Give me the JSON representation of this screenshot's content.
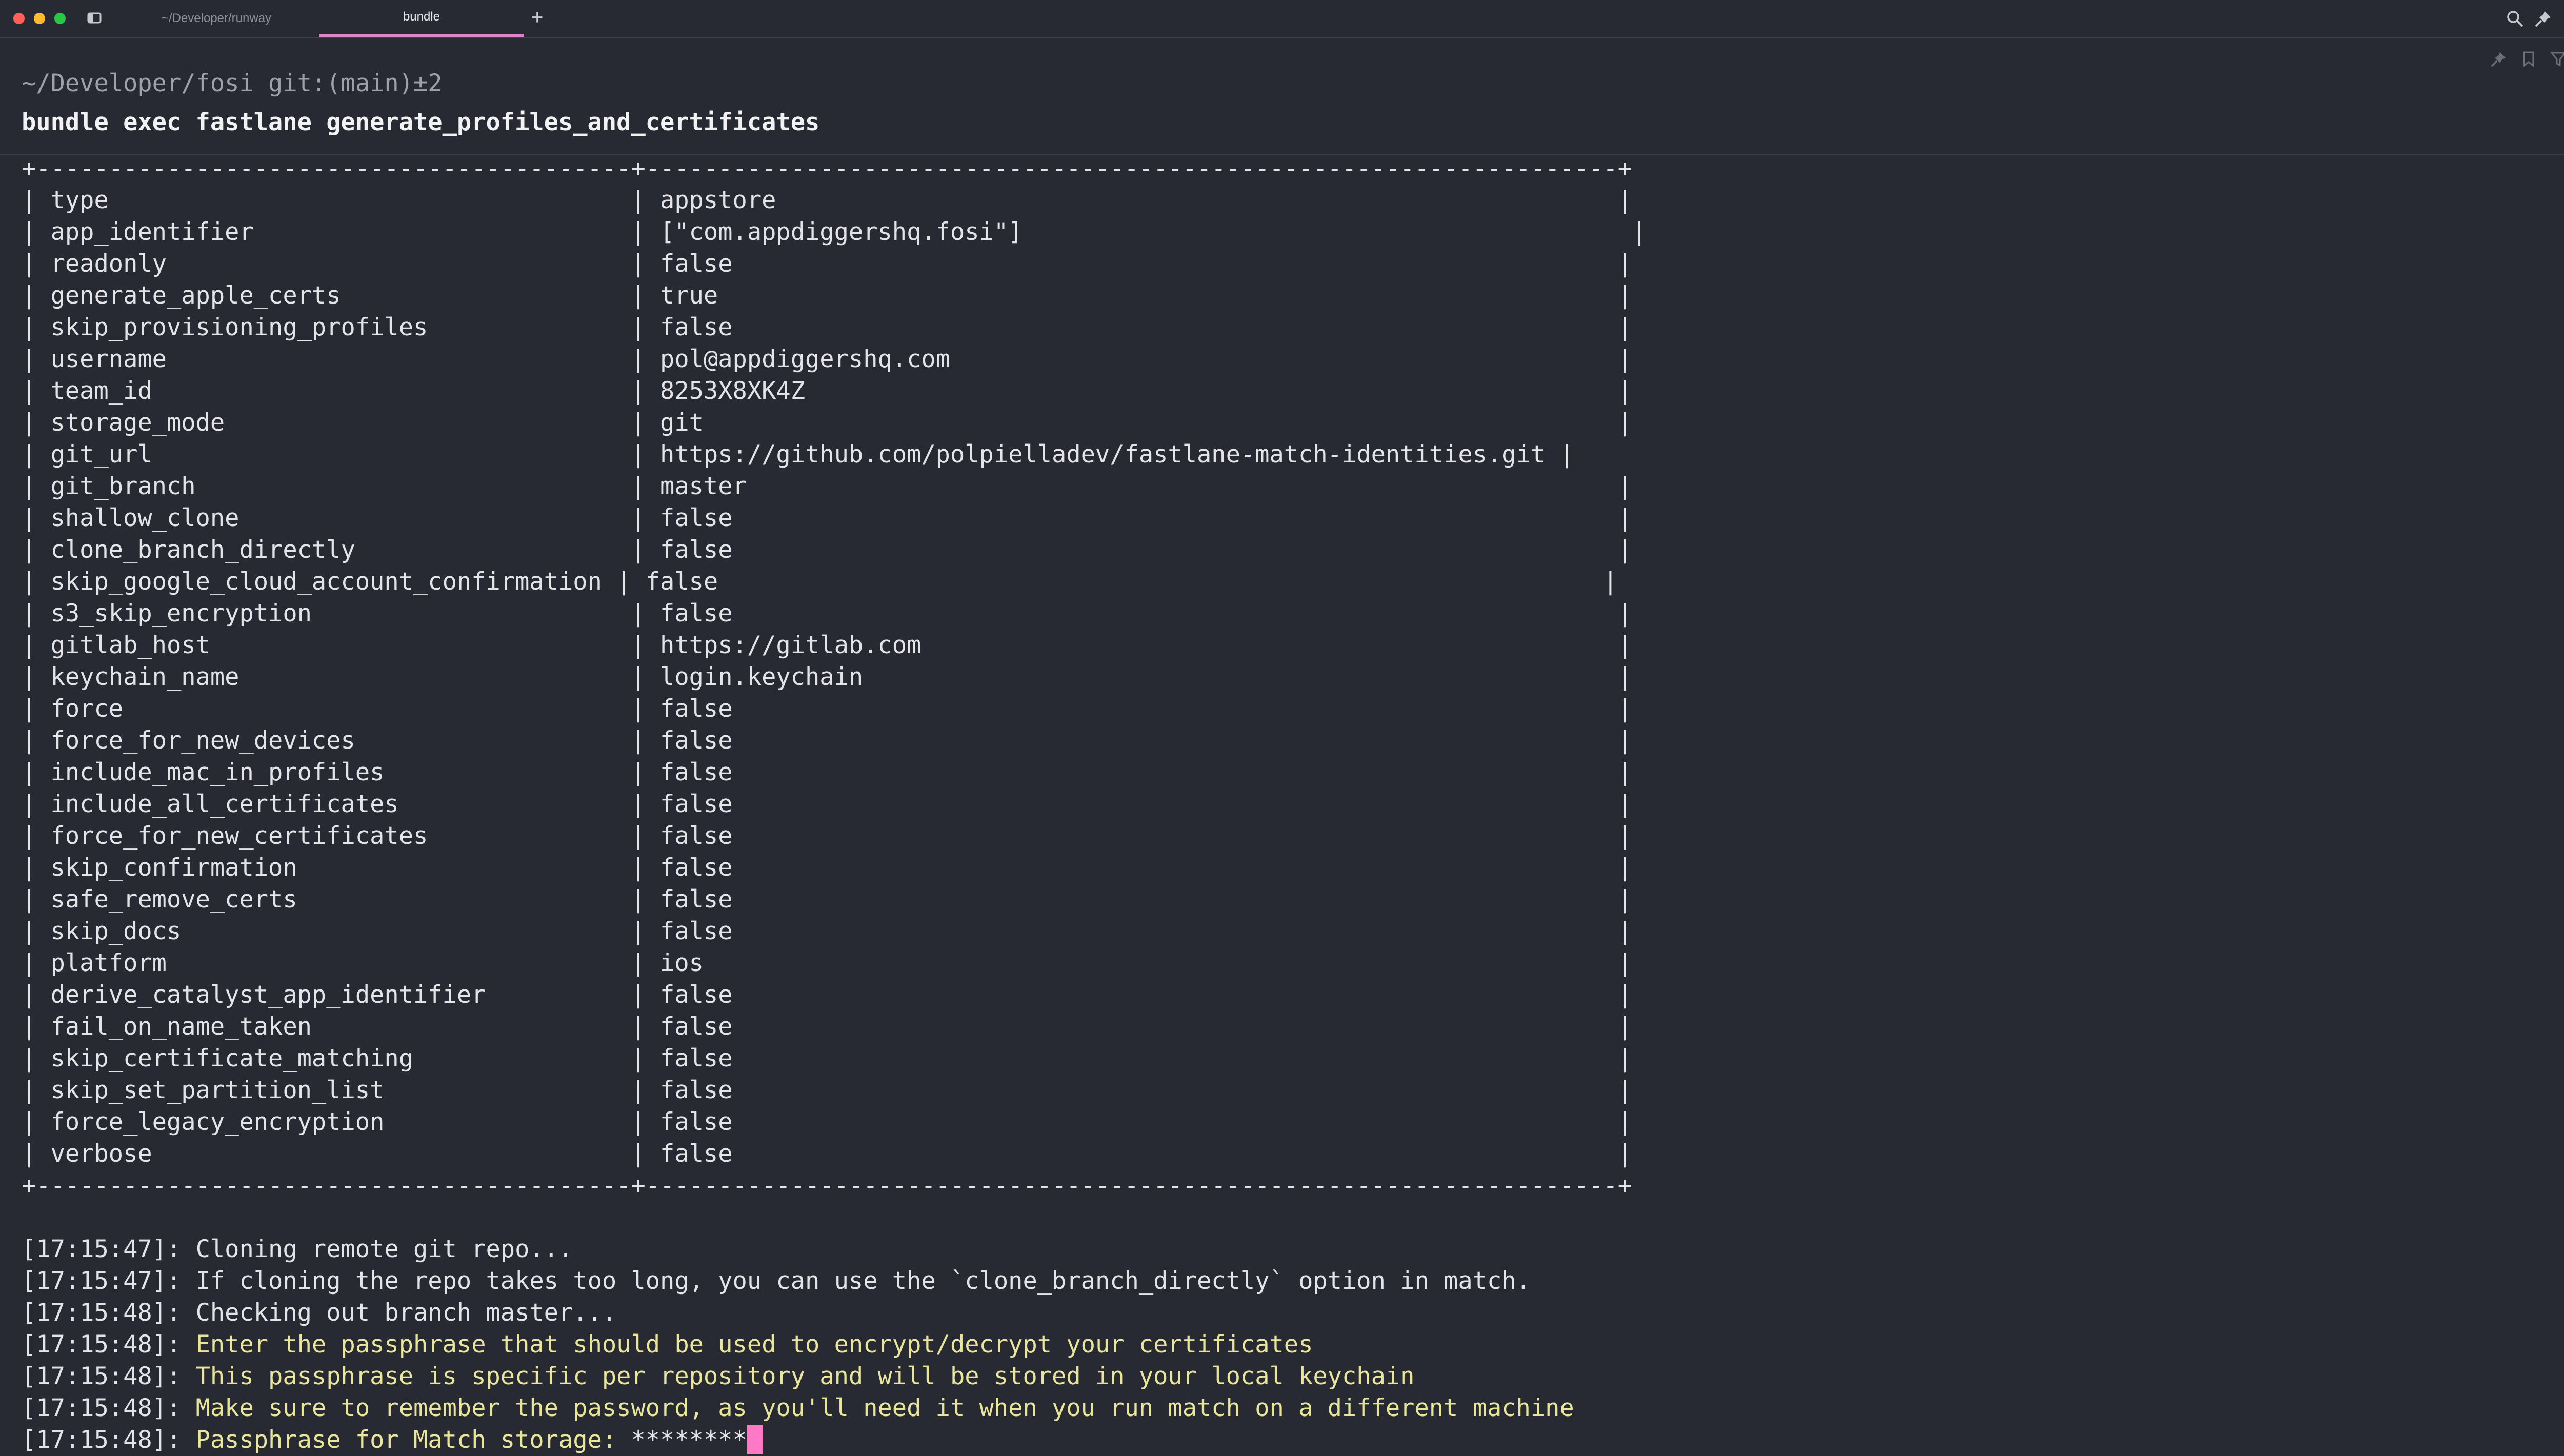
{
  "window": {
    "tabs": [
      {
        "label": "~/Developer/runway",
        "active": false
      },
      {
        "label": "bundle",
        "active": true
      }
    ],
    "new_tab_label": "+",
    "toolbar_icons": [
      "search-icon",
      "pin-icon",
      "bulb-icon",
      "settings-icon"
    ]
  },
  "terminal": {
    "prompt": "~/Developer/fosi git:(main)±2",
    "command": "bundle exec fastlane generate_profiles_and_certificates",
    "tool_icons": [
      "pin-icon",
      "bookmark-icon",
      "filter-icon",
      "more-icon"
    ],
    "table_border": "+-----------------------------------------+-------------------------------------------------------------------+",
    "table_rows": [
      "| type                                    | appstore                                                          |",
      "| app_identifier                          | [\"com.appdiggershq.fosi\"]                                          |",
      "| readonly                                | false                                                             |",
      "| generate_apple_certs                    | true                                                              |",
      "| skip_provisioning_profiles              | false                                                             |",
      "| username                                | pol@appdiggershq.com                                              |",
      "| team_id                                 | 8253X8XK4Z                                                        |",
      "| storage_mode                            | git                                                               |",
      "| git_url                                 | https://github.com/polpielladev/fastlane-match-identities.git |",
      "| git_branch                              | master                                                            |",
      "| shallow_clone                           | false                                                             |",
      "| clone_branch_directly                   | false                                                             |",
      "| skip_google_cloud_account_confirmation | false                                                             |",
      "| s3_skip_encryption                      | false                                                             |",
      "| gitlab_host                             | https://gitlab.com                                                |",
      "| keychain_name                           | login.keychain                                                    |",
      "| force                                   | false                                                             |",
      "| force_for_new_devices                   | false                                                             |",
      "| include_mac_in_profiles                 | false                                                             |",
      "| include_all_certificates                | false                                                             |",
      "| force_for_new_certificates              | false                                                             |",
      "| skip_confirmation                       | false                                                             |",
      "| safe_remove_certs                       | false                                                             |",
      "| skip_docs                               | false                                                             |",
      "| platform                                | ios                                                               |",
      "| derive_catalyst_app_identifier          | false                                                             |",
      "| fail_on_name_taken                      | false                                                             |",
      "| skip_certificate_matching               | false                                                             |",
      "| skip_set_partition_list                 | false                                                             |",
      "| force_legacy_encryption                 | false                                                             |",
      "| verbose                                 | false                                                             |"
    ],
    "log": [
      {
        "ts": "[17:15:47]: ",
        "msg": "Cloning remote git repo...",
        "highlight": false
      },
      {
        "ts": "[17:15:47]: ",
        "msg": "If cloning the repo takes too long, you can use the `clone_branch_directly` option in match.",
        "highlight": false
      },
      {
        "ts": "[17:15:48]: ",
        "msg": "Checking out branch master...",
        "highlight": false
      },
      {
        "ts": "[17:15:48]: ",
        "msg": "Enter the passphrase that should be used to encrypt/decrypt your certificates",
        "highlight": true
      },
      {
        "ts": "[17:15:48]: ",
        "msg": "This passphrase is specific per repository and will be stored in your local keychain",
        "highlight": true
      },
      {
        "ts": "[17:15:48]: ",
        "msg": "Make sure to remember the password, as you'll need it when you run match on a different machine",
        "highlight": true
      },
      {
        "ts": "[17:15:48]: ",
        "msg": "Passphrase for Match storage: ",
        "highlight": true
      }
    ],
    "password_mask": "********"
  },
  "colors": {
    "background": "#282a33",
    "text": "#e4e4e8",
    "highlight": "#e9e69b",
    "cursor": "#ff79c6",
    "tab_accent": "#d986c4"
  }
}
